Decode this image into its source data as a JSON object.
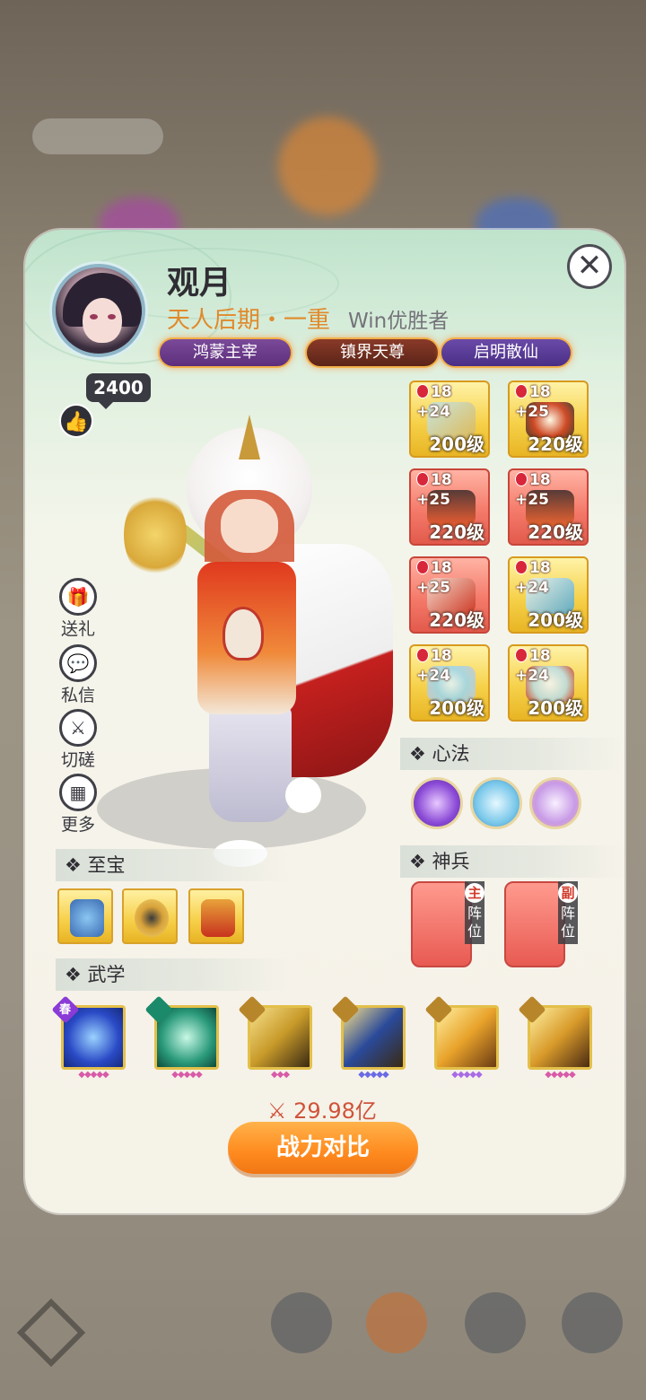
{
  "player": {
    "name": "观月",
    "realm": "天人后期・一重",
    "title": "Win优胜者",
    "likes": "2400"
  },
  "badges": [
    "鸿蒙主宰",
    "镇界天尊",
    "启明散仙"
  ],
  "side_actions": [
    {
      "label": "送礼",
      "icon": "gift-icon"
    },
    {
      "label": "私信",
      "icon": "chat-icon"
    },
    {
      "label": "切磋",
      "icon": "swords-icon"
    },
    {
      "label": "更多",
      "icon": "grid-icon"
    }
  ],
  "equipment": [
    {
      "refine": "18",
      "plus": "+24",
      "level": "200级",
      "rarity": "gold"
    },
    {
      "refine": "18",
      "plus": "+25",
      "level": "220级",
      "rarity": "gold"
    },
    {
      "refine": "18",
      "plus": "+25",
      "level": "220级",
      "rarity": "red"
    },
    {
      "refine": "18",
      "plus": "+25",
      "level": "220级",
      "rarity": "red"
    },
    {
      "refine": "18",
      "plus": "+25",
      "level": "220级",
      "rarity": "red"
    },
    {
      "refine": "18",
      "plus": "+24",
      "level": "200级",
      "rarity": "gold"
    },
    {
      "refine": "18",
      "plus": "+24",
      "level": "200级",
      "rarity": "gold"
    },
    {
      "refine": "18",
      "plus": "+24",
      "level": "200级",
      "rarity": "gold"
    }
  ],
  "sections": {
    "xinfa": "心法",
    "shenbing": "神兵",
    "zhibao": "至宝",
    "wuxue": "武学"
  },
  "shenbing": [
    {
      "tag": "主",
      "label": "阵位"
    },
    {
      "tag": "副",
      "label": "阵位"
    }
  ],
  "skill_corner_text": "春",
  "power": "29.98亿",
  "compare_button": "战力对比",
  "colors": {
    "accent_orange": "#ff8a1e",
    "realm_text": "#e08a2c",
    "gold_item": "#f6d14a",
    "red_item": "#f47a6a"
  }
}
